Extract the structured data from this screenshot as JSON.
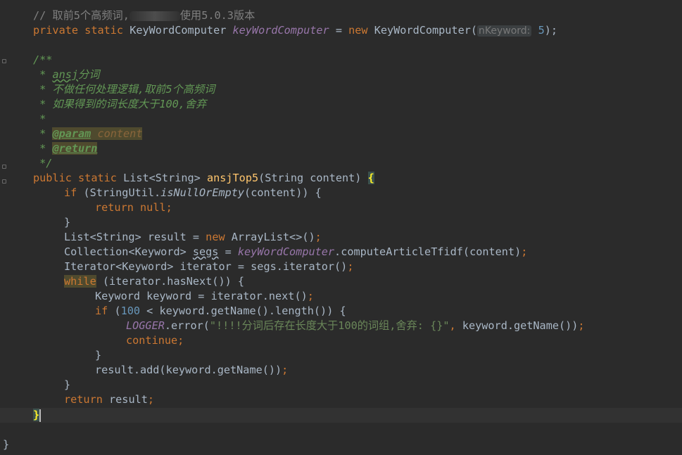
{
  "editor": {
    "l1": {
      "comment_a": "// 取前5个高频词,",
      "comment_b": "使用5.0.3版本"
    },
    "l2": {
      "private": "private",
      "static": "static",
      "type": "KeyWordComputer",
      "field": "keyWordComputer",
      "eq": " = ",
      "new": "new",
      "ctor": "KeyWordComputer(",
      "hint": "nKeyword:",
      "arg": "5",
      "end": ");"
    },
    "doc": {
      "open": "/**",
      "l1_star": " * ",
      "l1_word": "ansj",
      "l1_rest": "分词",
      "l2": " * 不做任何处理逻辑,取前5个高频词",
      "l3": " * 如果得到的词长度大于100,舍弃",
      "l4": " *",
      "param_star": " * ",
      "param_tag": "@param",
      "param_name": "content",
      "return_star": " * ",
      "return_tag": "@return",
      "close": " */"
    },
    "sig": {
      "public": "public",
      "static": "static",
      "ret": "List<String>",
      "name": "ansjTop5",
      "params": "(String content) ",
      "brace": "{"
    },
    "if1": {
      "if": "if",
      "a": " (StringUtil.",
      "call": "isNullOrEmpty",
      "b": "(content)) {"
    },
    "ret_null": {
      "return": "return",
      "null": "null",
      "semi": ";"
    },
    "close1": "}",
    "result": {
      "a": "List<String> result = ",
      "new": "new",
      "b": " ArrayList<>()",
      "semi": ";"
    },
    "segs": {
      "a": "Collection<Keyword> ",
      "var": "segs",
      "b": " = ",
      "field": "keyWordComputer",
      "c": ".computeArticleTfidf(content)",
      "semi": ";"
    },
    "iter": {
      "a": "Iterator<Keyword> iterator = segs.iterator()",
      "semi": ";"
    },
    "while": {
      "kw": "while",
      "rest": " (iterator.hasNext()) {"
    },
    "kwline": {
      "a": "Keyword keyword = iterator.next()",
      "semi": ";"
    },
    "if2": {
      "if": "if",
      "sp": " (",
      "num": "100",
      "rest": " < keyword.getName().length()) {"
    },
    "log": {
      "logger": "LOGGER",
      "a": ".error(",
      "str": "\"!!!!分词后存在长度大于100的词组,舍弃: {}\"",
      "comma": ",",
      "b": " keyword.getName())",
      "semi": ";"
    },
    "cont": {
      "kw": "continue",
      "semi": ";"
    },
    "close2": "}",
    "add": {
      "a": "result.add(keyword.getName())",
      "semi": ";"
    },
    "close3": "}",
    "ret": {
      "kw": "return",
      "rest": " result",
      "semi": ";"
    },
    "close_method": "}",
    "close_class": "}"
  }
}
